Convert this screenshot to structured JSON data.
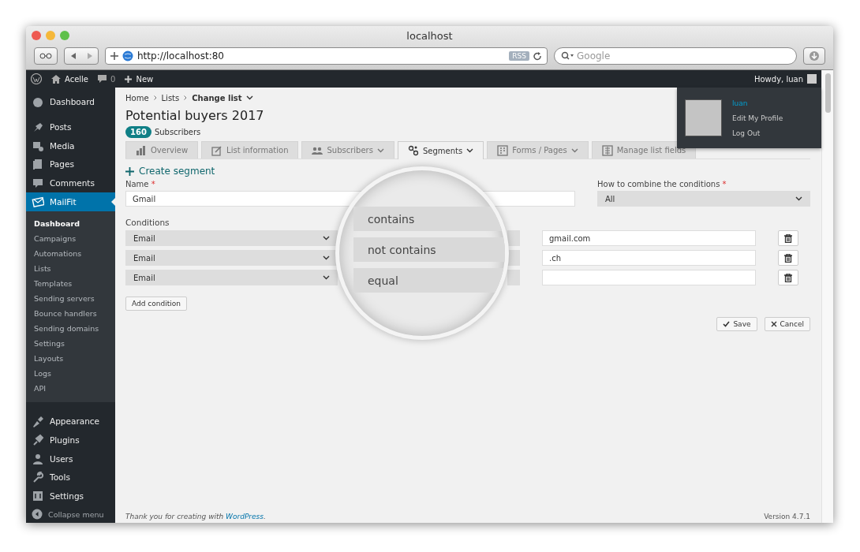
{
  "browser": {
    "title": "localhost",
    "url": "http://localhost:80",
    "rss": "RSS",
    "search_placeholder": "Google"
  },
  "admin_bar": {
    "site": "Acelle",
    "comments": "0",
    "new": "New",
    "greeting": "Howdy, luan"
  },
  "user_menu": {
    "name": "luan",
    "items": [
      "Edit My Profile",
      "Log Out"
    ]
  },
  "sidebar": {
    "items": [
      {
        "label": "Dashboard",
        "selected": false
      },
      {
        "label": "Posts",
        "selected": false
      },
      {
        "label": "Media",
        "selected": false
      },
      {
        "label": "Pages",
        "selected": false
      },
      {
        "label": "Comments",
        "selected": false
      },
      {
        "label": "MailFit",
        "selected": true,
        "children": [
          {
            "label": "Dashboard",
            "selected": true
          },
          {
            "label": "Campaigns",
            "selected": false
          },
          {
            "label": "Automations",
            "selected": false
          },
          {
            "label": "Lists",
            "selected": false
          },
          {
            "label": "Templates",
            "selected": false
          },
          {
            "label": "Sending servers",
            "selected": false
          },
          {
            "label": "Bounce handlers",
            "selected": false
          },
          {
            "label": "Sending domains",
            "selected": false
          },
          {
            "label": "Settings",
            "selected": false
          },
          {
            "label": "Layouts",
            "selected": false
          },
          {
            "label": "Logs",
            "selected": false
          },
          {
            "label": "API",
            "selected": false
          }
        ]
      },
      {
        "label": "Appearance",
        "selected": false
      },
      {
        "label": "Plugins",
        "selected": false
      },
      {
        "label": "Users",
        "selected": false
      },
      {
        "label": "Tools",
        "selected": false
      },
      {
        "label": "Settings",
        "selected": false
      }
    ],
    "collapse": "Collapse menu"
  },
  "breadcrumb": [
    "Home",
    "Lists"
  ],
  "change_list": "Change list",
  "title": "Potential buyers 2017",
  "subscriber_count": "160",
  "subscribers_label": "Subscribers",
  "tabs": [
    {
      "label": "Overview",
      "selected": false,
      "dropdown": false
    },
    {
      "label": "List information",
      "selected": false,
      "dropdown": false
    },
    {
      "label": "Subscribers",
      "selected": false,
      "dropdown": true
    },
    {
      "label": "Segments",
      "selected": true,
      "dropdown": true
    },
    {
      "label": "Forms / Pages",
      "selected": false,
      "dropdown": true
    },
    {
      "label": "Manage list fields",
      "selected": false,
      "dropdown": false
    }
  ],
  "create_segment": "Create segment",
  "name_field": {
    "label": "Name",
    "required_mark": "*",
    "value": "Gmail"
  },
  "combine": {
    "label": "How to combine the conditions",
    "required_mark": "*",
    "value": "All"
  },
  "conditions": {
    "label": "Conditions",
    "rows": [
      {
        "field": "Email",
        "operator": "contains",
        "value": "gmail.com"
      },
      {
        "field": "Email",
        "operator": "not contains",
        "value": ".ch"
      },
      {
        "field": "Email",
        "operator": "equal",
        "value": ""
      }
    ]
  },
  "add_condition": "Add condition",
  "save": "Save",
  "cancel": "Cancel",
  "footer": {
    "text": "Thank you for creating with",
    "link": "WordPress",
    "suffix": "."
  },
  "version": "Version 4.7.1"
}
